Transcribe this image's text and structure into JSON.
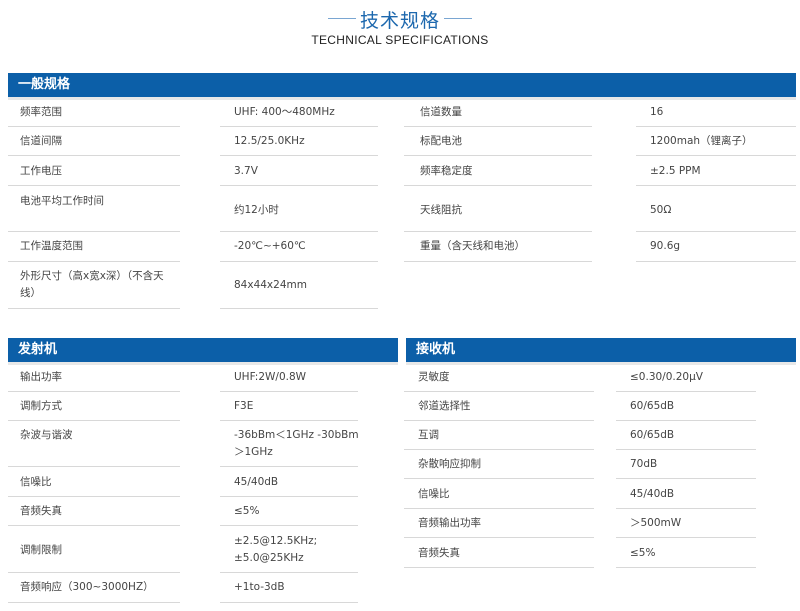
{
  "header": {
    "title_cn": "技术规格",
    "title_en": "TECHNICAL SPECIFICATIONS"
  },
  "general": {
    "title": "一般规格",
    "rows": [
      {
        "k1": "频率范围",
        "v1": "UHF: 400～480MHz",
        "k2": "信道数量",
        "v2": "16"
      },
      {
        "k1": "信道间隔",
        "v1": "12.5/25.0KHz",
        "k2": "标配电池",
        "v2": "1200mah（锂离子）"
      },
      {
        "k1": "工作电压",
        "v1": "3.7V",
        "k2": "频率稳定度",
        "v2": "±2.5 PPM"
      },
      {
        "k1": "电池平均工作时间",
        "v1": "约12小时",
        "k2": "天线阻抗",
        "v2": "50Ω"
      },
      {
        "k1": "工作温度范围",
        "v1": "-20℃~+60℃",
        "k2": "重量（含天线和电池）",
        "v2": "90.6g"
      },
      {
        "k1a": "外形尺寸（高x宽x深）（不含天",
        "k1b": "线）",
        "v1": "84x44x24mm"
      }
    ]
  },
  "transmitter": {
    "title": "发射机",
    "rows": [
      {
        "k": "输出功率",
        "v": "UHF:2W/0.8W"
      },
      {
        "k": "调制方式",
        "v": "F3E"
      },
      {
        "k": "杂波与谐波",
        "va": "-36bBm＜1GHz -30bBm",
        "vb": "＞1GHz"
      },
      {
        "k": "信噪比",
        "v": "45/40dB"
      },
      {
        "k": "音频失真",
        "v": "≤5%"
      },
      {
        "k": "调制限制",
        "va": "±2.5@12.5KHz;",
        "vb": "±5.0@25KHz"
      },
      {
        "k": "音频响应（300~3000HZ）",
        "v": "+1to-3dB"
      }
    ]
  },
  "receiver": {
    "title": "接收机",
    "rows": [
      {
        "k": "灵敏度",
        "v": "≤0.30/0.20μV"
      },
      {
        "k": "邻道选择性",
        "v": "60/65dB"
      },
      {
        "k": "互调",
        "v": "60/65dB"
      },
      {
        "k": "杂散响应抑制",
        "v": "70dB"
      },
      {
        "k": "信噪比",
        "v": "45/40dB"
      },
      {
        "k": "音频输出功率",
        "v": "＞500mW"
      },
      {
        "k": "音频失真",
        "v": "≤5%"
      }
    ]
  },
  "colors": {
    "accent": "#0c5fa8",
    "title_blue": "#1d68ae"
  }
}
